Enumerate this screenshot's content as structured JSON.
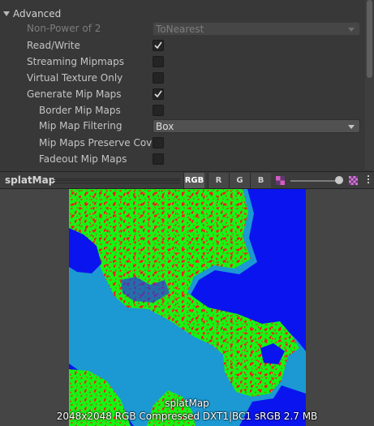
{
  "inspector": {
    "section_label": "Advanced",
    "rows": [
      {
        "label": "Non-Power of 2",
        "type": "dropdown",
        "value": "ToNearest",
        "disabled": true
      },
      {
        "label": "Read/Write",
        "type": "checkbox",
        "checked": true
      },
      {
        "label": "Streaming Mipmaps",
        "type": "checkbox",
        "checked": false
      },
      {
        "label": "Virtual Texture Only",
        "type": "checkbox",
        "checked": false
      },
      {
        "label": "Generate Mip Maps",
        "type": "checkbox",
        "checked": true
      },
      {
        "label": "Border Mip Maps",
        "type": "checkbox",
        "checked": false
      },
      {
        "label": "Mip Map Filtering",
        "type": "dropdown",
        "value": "Box",
        "disabled": false
      },
      {
        "label": "Mip Maps Preserve Coverage",
        "type": "checkbox",
        "checked": false
      },
      {
        "label": "Fadeout Mip Maps",
        "type": "checkbox",
        "checked": false
      }
    ]
  },
  "preview": {
    "title": "splatMap",
    "channels": [
      "RGB",
      "R",
      "G",
      "B"
    ],
    "active_channel": "RGB",
    "icons": [
      "alpha-toggle-icon",
      "mip-slider-icon",
      "checker-icon",
      "menu-icon"
    ],
    "texture_name": "splatMap",
    "texture_info": "2048x2048  RGB Compressed DXT1|BC1 sRGB  2.7 MB"
  },
  "colors": {
    "background": "#383838",
    "splat_red": "#ff1a1a",
    "splat_green": "#14f514",
    "splat_blue": "#0a14ee"
  }
}
